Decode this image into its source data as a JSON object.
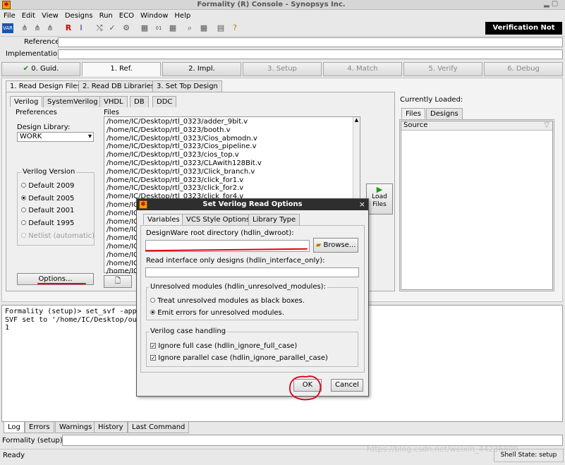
{
  "window": {
    "title": "Formality (R) Console - Synopsys Inc."
  },
  "menu": [
    "File",
    "Edit",
    "View",
    "Designs",
    "Run",
    "ECO",
    "Window",
    "Help"
  ],
  "status_badge": "Verification Not Run",
  "fields": {
    "reference_label": "Reference:",
    "implementation_label": "Implementation:"
  },
  "flow_steps": [
    "0. Guid.",
    "1. Ref.",
    "2. Impl.",
    "3. Setup",
    "4. Match",
    "5. Verify",
    "6. Debug"
  ],
  "ref_tabs": [
    "1. Read Design Files",
    "2. Read DB Libraries",
    "3. Set Top Design"
  ],
  "format_tabs": [
    "Verilog",
    "SystemVerilog",
    "VHDL",
    "DB",
    "DDC"
  ],
  "preferences": {
    "title": "Preferences",
    "library_label": "Design Library:",
    "library_value": "WORK"
  },
  "verilog_version": {
    "title": "Verilog Version",
    "options": [
      "Default 2009",
      "Default 2005",
      "Default 2001",
      "Default 1995",
      "Netlist (automatic)"
    ]
  },
  "options_button": "Options...",
  "files": {
    "title": "Files",
    "items": [
      "/home/IC/Desktop/rtl_0323/adder_9bit.v",
      "/home/IC/Desktop/rtl_0323/booth.v",
      "/home/IC/Desktop/rtl_0323/Cios_abmodn.v",
      "/home/IC/Desktop/rtl_0323/Cios_pipeline.v",
      "/home/IC/Desktop/rtl_0323/cios_top.v",
      "/home/IC/Desktop/rtl_0323/CLAwith128Bit.v",
      "/home/IC/Desktop/rtl_0323/Click_branch.v",
      "/home/IC/Desktop/rtl_0323/click_for1.v",
      "/home/IC/Desktop/rtl_0323/click_for2.v",
      "/home/IC/Desktop/rtl_0323/click_for4.v",
      "/home/IC/",
      "/home/IC/",
      "/home/IC/",
      "/home/IC/",
      "/home/IC/",
      "/home/IC/",
      "/home/IC/",
      "/home/IC/",
      "/home/IC/"
    ]
  },
  "load_files": {
    "line1": "Load",
    "line2": "Files"
  },
  "loaded": {
    "title": "Currently Loaded:",
    "tabs": [
      "Files",
      "Designs"
    ],
    "column": "Source"
  },
  "console": {
    "lines": [
      "Formality (setup)> set_svf -append {",
      "SVF set to '/home/IC/Desktop/output_",
      "1"
    ]
  },
  "bottom_tabs": [
    "Log",
    "Errors",
    "Warnings",
    "History",
    "Last Command"
  ],
  "prompt": "Formality (setup)>",
  "status": {
    "left": "Ready",
    "right": "Shell State: setup",
    "watermark": "https://blog.csdn.net/weixin_44236800"
  },
  "dialog": {
    "title": "Set Verilog Read Options",
    "tabs": [
      "Variables",
      "VCS Style Options",
      "Library Type"
    ],
    "dw_label": "DesignWare root directory  (hdlin_dwroot):",
    "dw_value": "",
    "browse": "Browse...",
    "iface_label": "Read interface only designs  (hdlin_interface_only):",
    "iface_value": "",
    "unresolved_title": "Unresolved modules (hdlin_unresolved_modules):",
    "unresolved_options": [
      "Treat unresolved modules as black boxes.",
      "Emit errors for unresolved modules."
    ],
    "case_title": "Verilog case handling",
    "case_options": [
      "Ignore full case (hdlin_ignore_full_case)",
      "Ignore parallel case (hdlin_ignore_parallel_case)"
    ],
    "ok": "OK",
    "cancel": "Cancel"
  }
}
